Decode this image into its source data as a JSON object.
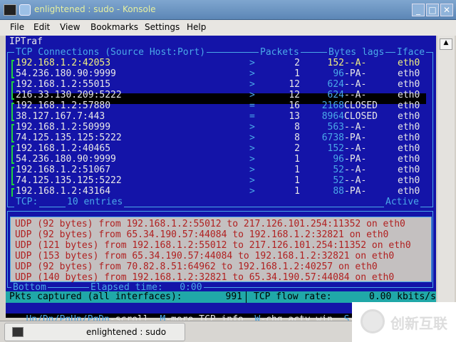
{
  "window": {
    "title": "enlightened : sudo - Konsole"
  },
  "menu": [
    "File",
    "Edit",
    "View",
    "Bookmarks",
    "Settings",
    "Help"
  ],
  "iptraf": {
    "app": "IPTraf",
    "header": {
      "conn": "TCP Connections (Source Host:Port)",
      "packets": "Packets",
      "bytes": "Bytes lags",
      "iface": "Iface"
    },
    "rows": [
      {
        "host": "192.168.1.2:42053",
        "dir": ">",
        "packets": "2",
        "bytes": "152",
        "flags": "--A-",
        "iface": "eth0"
      },
      {
        "host": "54.236.180.90:9999",
        "dir": ">",
        "packets": "1",
        "bytes": "96",
        "flags": "-PA-",
        "iface": "eth0"
      },
      {
        "host": "192.168.1.2:55015",
        "dir": ">",
        "packets": "12",
        "bytes": "624",
        "flags": "--A-",
        "iface": "eth0"
      },
      {
        "host": "216.33.130.209:5222",
        "dir": ">",
        "packets": "12",
        "bytes": "624",
        "flags": "--A-",
        "iface": "eth0"
      },
      {
        "host": "192.168.1.2:57880",
        "dir": "=",
        "packets": "16",
        "bytes": "2168",
        "flags": "CLOSED",
        "iface": "eth0"
      },
      {
        "host": "38.127.167.7:443",
        "dir": "=",
        "packets": "13",
        "bytes": "8964",
        "flags": "CLOSED",
        "iface": "eth0"
      },
      {
        "host": "192.168.1.2:50999",
        "dir": ">",
        "packets": "8",
        "bytes": "563",
        "flags": "--A-",
        "iface": "eth0"
      },
      {
        "host": "74.125.135.125:5222",
        "dir": ">",
        "packets": "8",
        "bytes": "6738",
        "flags": "-PA-",
        "iface": "eth0"
      },
      {
        "host": "192.168.1.2:40465",
        "dir": ">",
        "packets": "2",
        "bytes": "152",
        "flags": "--A-",
        "iface": "eth0"
      },
      {
        "host": "54.236.180.90:9999",
        "dir": ">",
        "packets": "1",
        "bytes": "96",
        "flags": "-PA-",
        "iface": "eth0"
      },
      {
        "host": "192.168.1.2:51067",
        "dir": ">",
        "packets": "1",
        "bytes": "52",
        "flags": "--A-",
        "iface": "eth0"
      },
      {
        "host": "74.125.135.125:5222",
        "dir": ">",
        "packets": "1",
        "bytes": "52",
        "flags": "--A-",
        "iface": "eth0"
      },
      {
        "host": "192.168.1.2:43164",
        "dir": ">",
        "packets": "1",
        "bytes": "88",
        "flags": "-PA-",
        "iface": "eth0"
      }
    ],
    "footer": {
      "label": "TCP:",
      "entries": "10 entries",
      "state": "Active"
    },
    "udp": [
      "UDP (92 bytes) from 192.168.1.2:55012 to 217.126.101.254:11352 on eth0",
      "UDP (92 bytes) from 65.34.190.57:44084 to 192.168.1.2:32821 on eth0",
      "UDP (121 bytes) from 192.168.1.2:55012 to 217.126.101.254:11352 on eth0",
      "UDP (153 bytes) from 65.34.190.57:44084 to 192.168.1.2:32821 on eth0",
      "UDP (92 bytes) from 70.82.8.51:64962 to 192.168.1.2:40257 on eth0",
      "UDP (140 bytes) from 192.168.1.2:32821 to 65.34.190.57:44084 on eth0"
    ],
    "bottom": {
      "label": "Bottom",
      "elapsed": "Elapsed time:   0:00"
    },
    "status": {
      "pkts_label": "Pkts captured (all interfaces):",
      "pkts": "991",
      "flow_label": "TCP flow rate:",
      "flow": "0.00 kbits/s"
    },
    "help": [
      {
        "key": "Up/Dn/PgUp/PgDn",
        "text": "-scroll"
      },
      {
        "key": "M",
        "text": "-more TCP info"
      },
      {
        "key": "W",
        "text": "-chg actv win"
      },
      {
        "key": "S",
        "text": "-"
      }
    ]
  },
  "taskbar": {
    "task": "enlightened : sudo"
  },
  "watermark": "创新互联"
}
